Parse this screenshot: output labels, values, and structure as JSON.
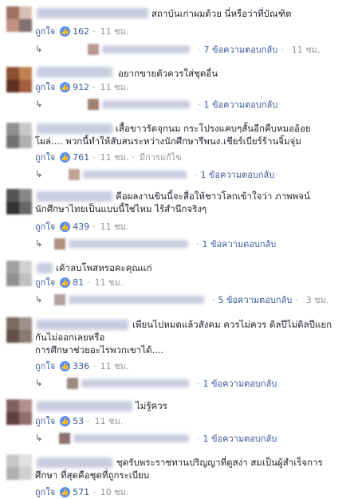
{
  "comments": [
    {
      "text_lines": [
        "สถาบันเก่าผมด้วย นี่หรือว่าที่บัณฑิต"
      ],
      "like_label": "ถูกใจ",
      "likes": "162",
      "time": "11 ชม.",
      "edited": "",
      "replies": "7 ข้อความตอบกลับ",
      "reply_time": "11 ชม."
    },
    {
      "text_lines": [
        "อยากขายตัวควรใส่ชุดอื่น"
      ],
      "like_label": "ถูกใจ",
      "likes": "912",
      "time": "11 ชม.",
      "edited": "",
      "replies": "1 ข้อความตอบกลับ",
      "reply_time": ""
    },
    {
      "text_lines": [
        "เสื้อขาวรัดจุกนม กระโปรงแคบๆสั้นอีกคืบหมออ้อย",
        "โผล่.... พวกนี้ทำให้สับสนระหว่างนักศึกษารึพนง.เชียร์เบียร์ร้านจิ้มจุ่ม"
      ],
      "like_label": "ถูกใจ",
      "likes": "761",
      "time": "11 ชม.",
      "edited": "มีการแก้ไข",
      "replies": "1 ข้อความตอบกลับ",
      "reply_time": ""
    },
    {
      "text_lines": [
        "คือผลงานขินนี้จะสื่อให้ชาวโลกเข้าใจว่า ภาพพจน์",
        "นักศึกษาไทยเป็นแบบนี้ใช่ไหม ไร้สำนึกจริงๆ"
      ],
      "like_label": "ถูกใจ",
      "likes": "439",
      "time": "11 ชม.",
      "edited": "",
      "replies": "1 ข้อความตอบกลับ",
      "reply_time": ""
    },
    {
      "text_lines": [
        "เค้าลบโพสหรอคะคุณแก่"
      ],
      "like_label": "ถูกใจ",
      "likes": "81",
      "time": "11 ชม.",
      "edited": "",
      "replies": "5 ข้อความตอบกลับ",
      "reply_time": "3 ชม."
    },
    {
      "text_lines": [
        "เพียนไปหมดแล้วสังคม ควรไม่ควร ดิลปีไม่ดิลปีแยก",
        "กันไม่ออกเลยหรือ",
        "การศึกษาช่วยอะไรพวกเขาได้...."
      ],
      "like_label": "ถูกใจ",
      "likes": "336",
      "time": "11 ชม.",
      "edited": "",
      "replies": "1 ข้อความตอบกลับ",
      "reply_time": ""
    },
    {
      "text_lines": [
        "ไม่รู้ควร"
      ],
      "like_label": "ถูกใจ",
      "likes": "53",
      "time": "11 ชม.",
      "edited": "",
      "replies": "1 ข้อความตอบกลับ",
      "reply_time": ""
    },
    {
      "text_lines": [
        "ชุดรับพระราชทานปริญญาที่ดูสง่า สมเป็นผู้สำเร็จการ",
        "ศึกษา ที่สุดคือชุดที่ถูกระเบียบ"
      ],
      "like_label": "ถูกใจ",
      "likes": "571",
      "time": "10 ชม.",
      "edited": "",
      "replies": "",
      "reply_time": ""
    }
  ],
  "colors": {
    "link": "#365899",
    "meta": "#90949c",
    "like_badge": "#5890ff",
    "text": "#1d2129"
  },
  "icons": {
    "like": "thumbs-up-icon",
    "reply": "reply-arrow-icon"
  }
}
